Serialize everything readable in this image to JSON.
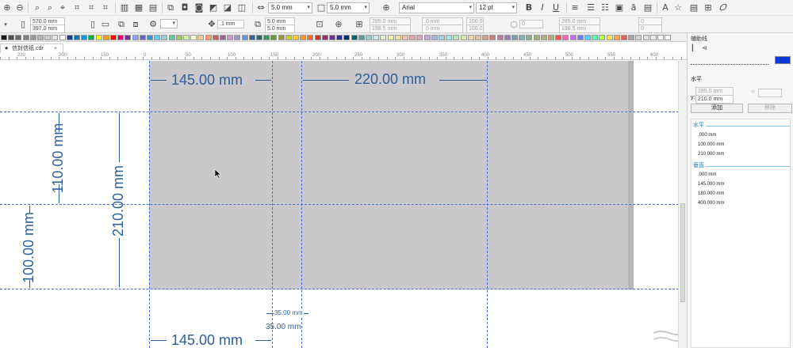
{
  "toolbar_top": {
    "width_value": "5.0 mm",
    "height_value": "5.0 mm",
    "font_name": "Arial",
    "font_size": "12 pt"
  },
  "toolbar_prop": {
    "doc_width": "570.0 mm",
    "doc_height": "397.0 mm",
    "nudge": ".1 mm",
    "dup_x": "5.0 mm",
    "dup_y": "5.0 mm",
    "pos_x": "285.0 mm",
    "pos_y": "198.5 mm",
    "size_w": ".0 mm",
    "size_h": ".0 mm",
    "scale_x": "100.0",
    "scale_y": "100.0",
    "angle": "0",
    "pos_x2": "285.0 mm",
    "pos_y2": "198.5 mm",
    "rot_a": "0",
    "rot_b": "0"
  },
  "palette": [
    "#1a1a1a",
    "#4d4d4d",
    "#6b6b6b",
    "#808080",
    "#999999",
    "#b3b3b3",
    "#cccccc",
    "#e6e6e6",
    "#ffffff",
    "#1f3f99",
    "#0070c0",
    "#00a0e0",
    "#00b050",
    "#ffff00",
    "#ff9900",
    "#ff0000",
    "#e60073",
    "#7030a0",
    "#9999ff",
    "#6666cc",
    "#3399cc",
    "#66ccff",
    "#99cccc",
    "#66cc99",
    "#99cc66",
    "#ccff99",
    "#ffffcc",
    "#ffcc99",
    "#ff9966",
    "#cc6666",
    "#996699",
    "#cc99cc",
    "#9999cc",
    "#6699cc",
    "#336699",
    "#336666",
    "#339966",
    "#669933",
    "#999933",
    "#cccc33",
    "#ffcc33",
    "#ff9933",
    "#ff6633",
    "#cc3333",
    "#993366",
    "#663399",
    "#333399",
    "#003366",
    "#006666",
    "#669999",
    "#99cccc",
    "#cce5e5",
    "#e5f2cc",
    "#f2f2a6",
    "#f2d9a6",
    "#f2bfa6",
    "#e6a6a6",
    "#d9a6bf",
    "#c2a6d9",
    "#a6b3d9",
    "#a6cfe6",
    "#a6e6e6",
    "#b3e6c2",
    "#d9e6a6",
    "#e6d9a6",
    "#e6bf99",
    "#d9998c",
    "#cc8080",
    "#b38099",
    "#9980b3",
    "#8099b3",
    "#80b3b3",
    "#80b399",
    "#99b380",
    "#b3b380",
    "#c2a680",
    "#ff4d4d",
    "#ff66b3",
    "#cc66ff",
    "#6680ff",
    "#4dd2ff",
    "#4dffb8",
    "#b3ff4d",
    "#ffe64d",
    "#ffa64d",
    "#e65c5c",
    "#a6a6a6",
    "#cfcfcf",
    "#e0e0e0",
    "#ebebeb",
    "#f5f5f5",
    "#fafafa"
  ],
  "document": {
    "tab_name": "信封信纸.cdr"
  },
  "ruler_labels": [
    "220",
    "200",
    "150",
    "0",
    "50",
    "100",
    "150",
    "200",
    "250",
    "300",
    "350",
    "400",
    "450",
    "500",
    "550",
    "600"
  ],
  "dimensions": {
    "top_left": "145.00 mm",
    "top_right": "220.00 mm",
    "left_upper": "110.00 mm",
    "left_full": "210.00 mm",
    "left_lower": "100.00 mm",
    "gap_small_top": "35.00 mm",
    "gap_small_bottom": "35.00 mm",
    "bottom_left": "145.00 mm"
  },
  "docker": {
    "title": "辅助线",
    "mode_label": "水平",
    "x_value": "285.0 mm",
    "y_label": "y:",
    "y_value": "210.0 mm",
    "add_label": "添加",
    "delete_label": "移除",
    "horizontal_header": "水平",
    "horizontal_items": [
      ".000 mm",
      "100.000 mm",
      "210.000 mm"
    ],
    "vertical_header": "垂直",
    "vertical_items": [
      ".000 mm",
      "145.000 mm",
      "180.000 mm",
      "400.000 mm"
    ],
    "accent_color": "#0b39d6"
  }
}
